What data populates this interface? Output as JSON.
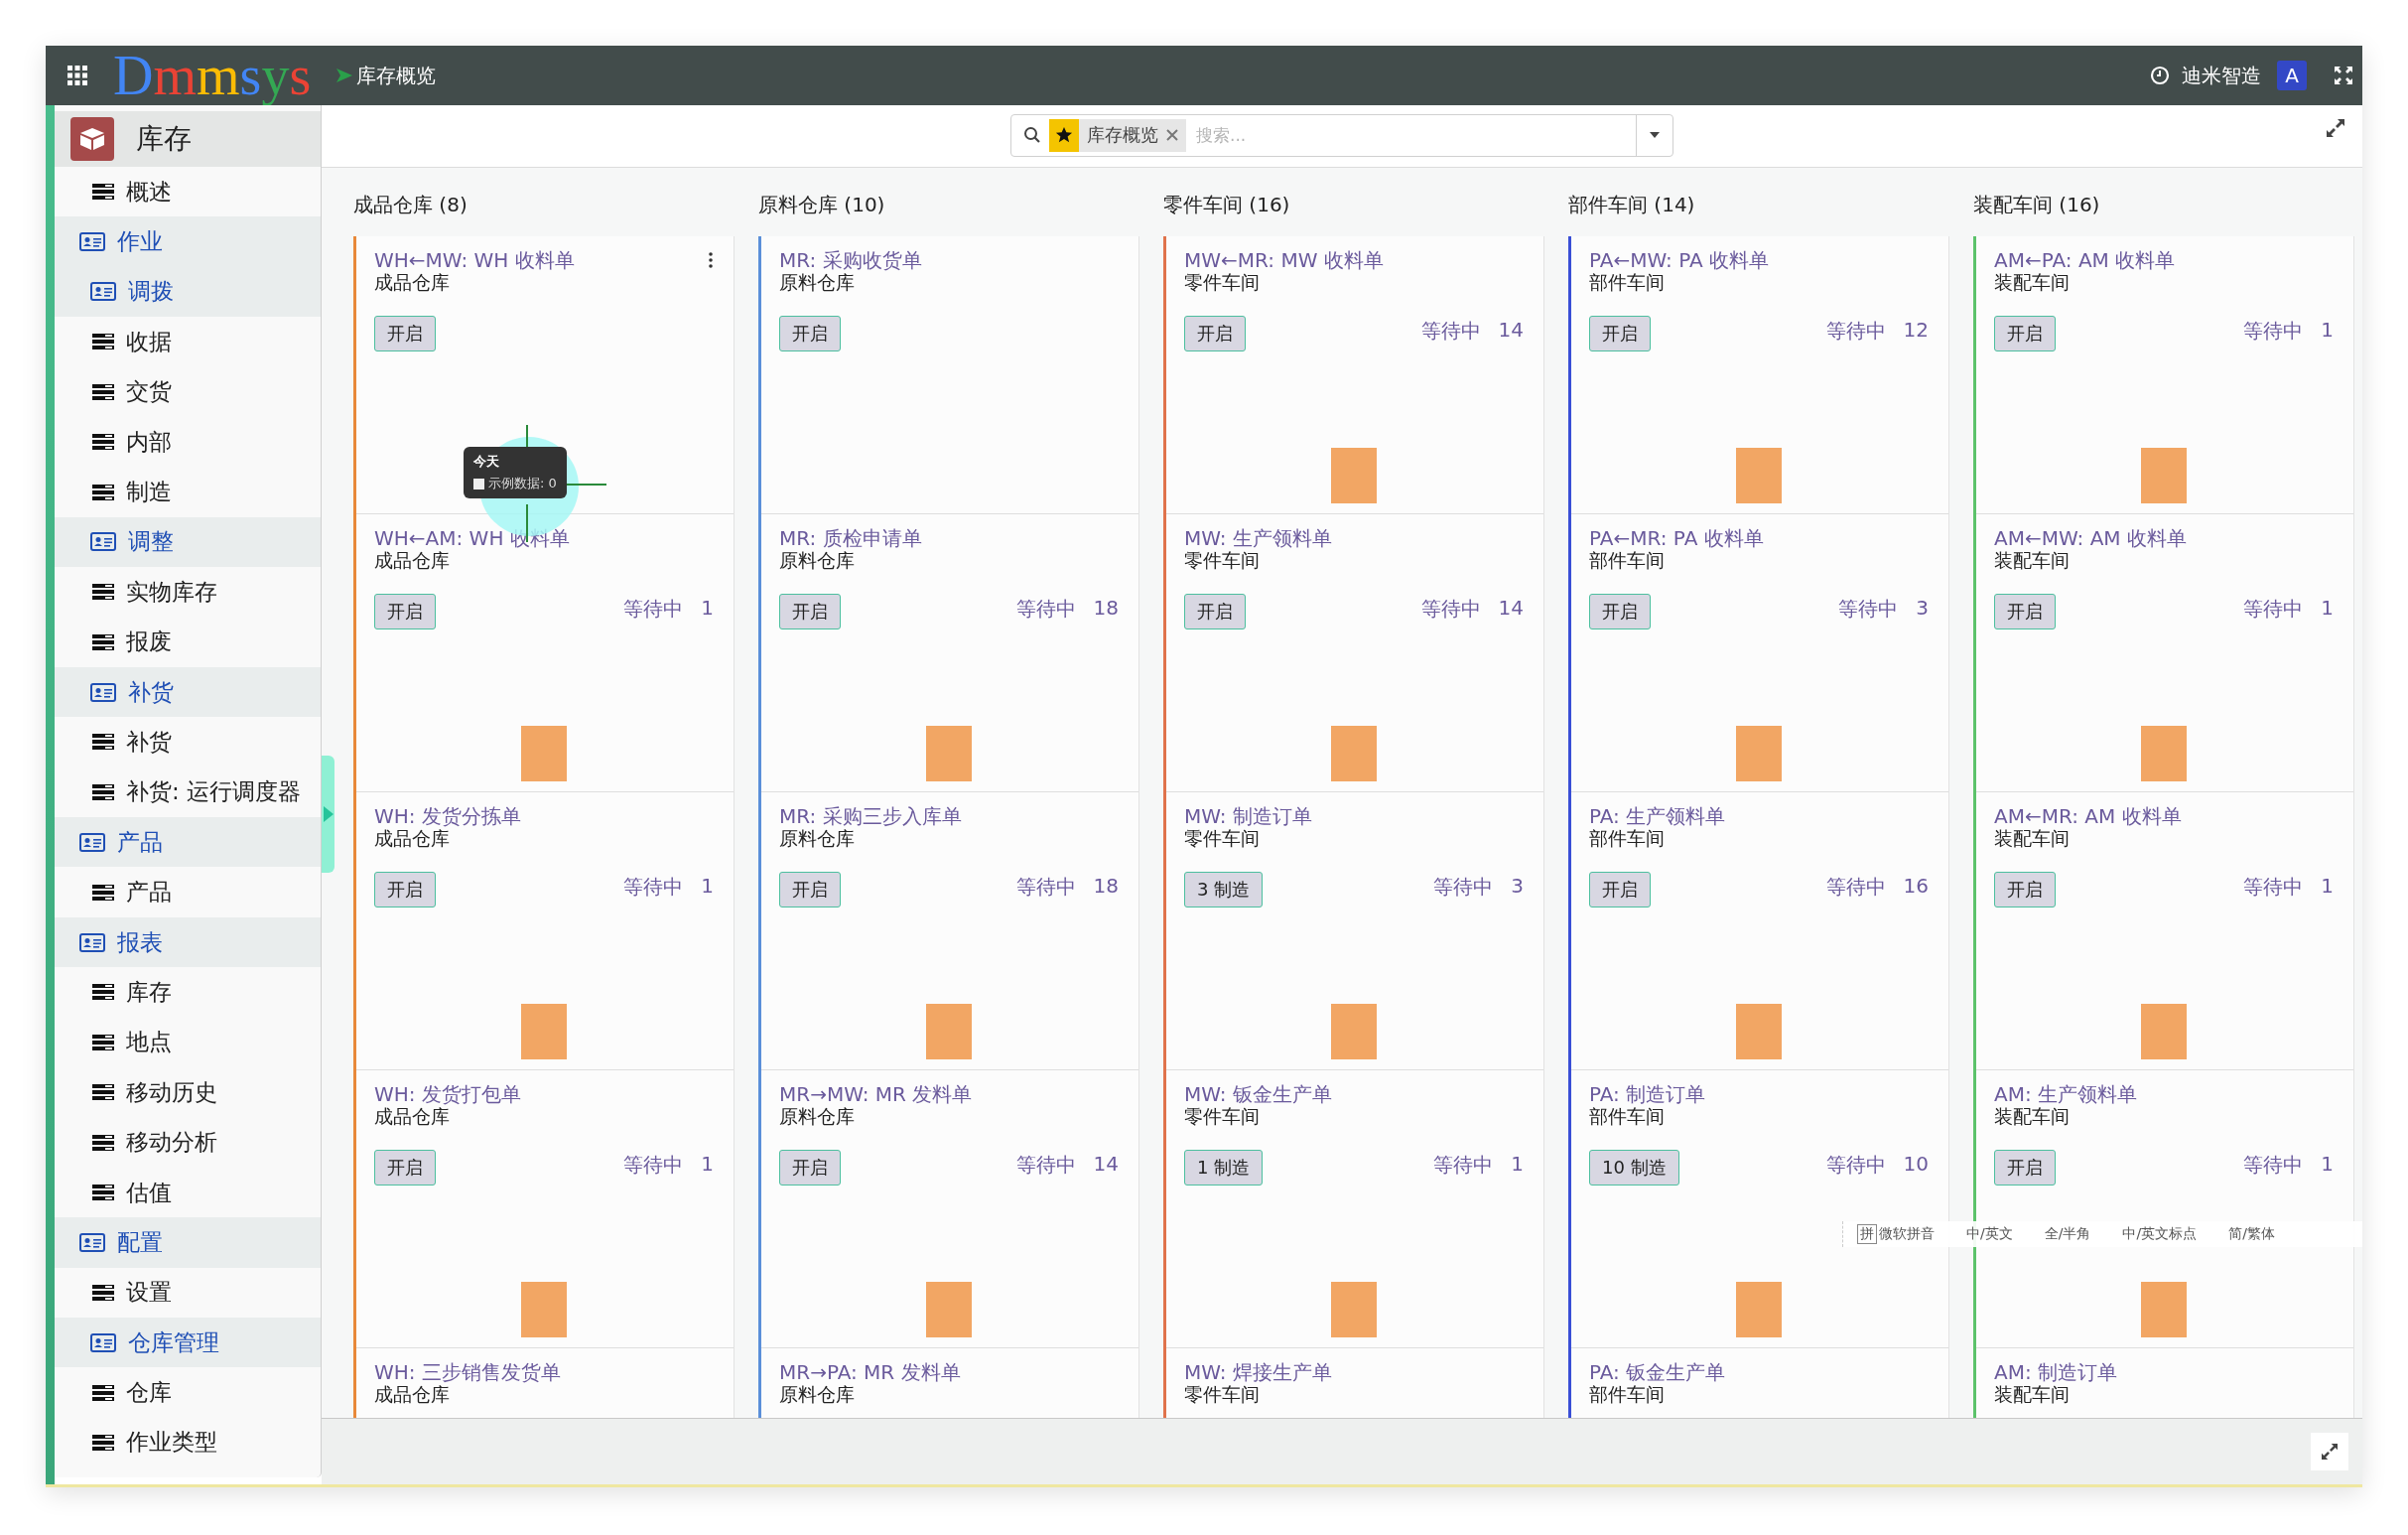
{
  "topbar": {
    "logo": "Dmmsys",
    "breadcrumb": "库存概览",
    "company": "迪米智造",
    "avatar": "A"
  },
  "sidebar": {
    "app": "库存",
    "items": [
      {
        "label": "概述",
        "kind": "item"
      },
      {
        "label": "作业",
        "kind": "section"
      },
      {
        "label": "调拨",
        "kind": "subsection"
      },
      {
        "label": "收据",
        "kind": "item"
      },
      {
        "label": "交货",
        "kind": "item"
      },
      {
        "label": "内部",
        "kind": "item"
      },
      {
        "label": "制造",
        "kind": "item"
      },
      {
        "label": "调整",
        "kind": "subsection"
      },
      {
        "label": "实物库存",
        "kind": "item"
      },
      {
        "label": "报废",
        "kind": "item"
      },
      {
        "label": "补货",
        "kind": "subsection"
      },
      {
        "label": "补货",
        "kind": "item"
      },
      {
        "label": "补货: 运行调度器",
        "kind": "item"
      },
      {
        "label": "产品",
        "kind": "section"
      },
      {
        "label": "产品",
        "kind": "item"
      },
      {
        "label": "报表",
        "kind": "section"
      },
      {
        "label": "库存",
        "kind": "item"
      },
      {
        "label": "地点",
        "kind": "item"
      },
      {
        "label": "移动历史",
        "kind": "item"
      },
      {
        "label": "移动分析",
        "kind": "item"
      },
      {
        "label": "估值",
        "kind": "item"
      },
      {
        "label": "配置",
        "kind": "section"
      },
      {
        "label": "设置",
        "kind": "item"
      },
      {
        "label": "仓库管理",
        "kind": "subsection"
      },
      {
        "label": "仓库",
        "kind": "item"
      },
      {
        "label": "作业类型",
        "kind": "item"
      }
    ]
  },
  "search": {
    "facet": "库存概览",
    "placeholder": "搜索..."
  },
  "columns": [
    {
      "title": "成品仓库 (8)",
      "color": "#e8893a",
      "cards": [
        {
          "title": "WH←MW: WH 收料单",
          "subtitle": "成品仓库",
          "button": "开启",
          "bar": false,
          "hovered": true,
          "tooltip": {
            "title": "今天",
            "text": "示例数据: 0"
          }
        },
        {
          "title": "WH←AM: WH 收料单",
          "subtitle": "成品仓库",
          "button": "开启",
          "waiting_label": "等待中",
          "waiting_count": "1",
          "bar": true,
          "hovered": false
        },
        {
          "title": "WH: 发货分拣单",
          "subtitle": "成品仓库",
          "button": "开启",
          "waiting_label": "等待中",
          "waiting_count": "1",
          "bar": true,
          "hovered": false
        },
        {
          "title": "WH: 发货打包单",
          "subtitle": "成品仓库",
          "button": "开启",
          "waiting_label": "等待中",
          "waiting_count": "1",
          "bar": true,
          "hovered": false
        },
        {
          "title": "WH: 三步销售发货单",
          "subtitle": "成品仓库",
          "bar": false,
          "hovered": false
        }
      ]
    },
    {
      "title": "原料仓库 (10)",
      "color": "#5b8fd9",
      "cards": [
        {
          "title": "MR: 采购收货单",
          "subtitle": "原料仓库",
          "button": "开启",
          "bar": false,
          "hovered": false
        },
        {
          "title": "MR: 质检申请单",
          "subtitle": "原料仓库",
          "button": "开启",
          "waiting_label": "等待中",
          "waiting_count": "18",
          "bar": true,
          "hovered": false
        },
        {
          "title": "MR: 采购三步入库单",
          "subtitle": "原料仓库",
          "button": "开启",
          "waiting_label": "等待中",
          "waiting_count": "18",
          "bar": true,
          "hovered": false
        },
        {
          "title": "MR→MW: MR 发料单",
          "subtitle": "原料仓库",
          "button": "开启",
          "waiting_label": "等待中",
          "waiting_count": "14",
          "bar": true,
          "hovered": false
        },
        {
          "title": "MR→PA: MR 发料单",
          "subtitle": "原料仓库",
          "bar": false,
          "hovered": false
        }
      ]
    },
    {
      "title": "零件车间 (16)",
      "color": "#e0734c",
      "cards": [
        {
          "title": "MW←MR: MW 收料单",
          "subtitle": "零件车间",
          "button": "开启",
          "waiting_label": "等待中",
          "waiting_count": "14",
          "bar": true,
          "hovered": false
        },
        {
          "title": "MW: 生产领料单",
          "subtitle": "零件车间",
          "button": "开启",
          "waiting_label": "等待中",
          "waiting_count": "14",
          "bar": true,
          "hovered": false
        },
        {
          "title": "MW: 制造订单",
          "subtitle": "零件车间",
          "button": "3 制造",
          "waiting_label": "等待中",
          "waiting_count": "3",
          "bar": true,
          "hovered": false
        },
        {
          "title": "MW: 钣金生产单",
          "subtitle": "零件车间",
          "button": "1 制造",
          "waiting_label": "等待中",
          "waiting_count": "1",
          "bar": true,
          "hovered": false
        },
        {
          "title": "MW: 焊接生产单",
          "subtitle": "零件车间",
          "bar": false,
          "hovered": false
        }
      ]
    },
    {
      "title": "部件车间 (14)",
      "color": "#3a4fd6",
      "cards": [
        {
          "title": "PA←MW: PA 收料单",
          "subtitle": "部件车间",
          "button": "开启",
          "waiting_label": "等待中",
          "waiting_count": "12",
          "bar": true,
          "hovered": false
        },
        {
          "title": "PA←MR: PA 收料单",
          "subtitle": "部件车间",
          "button": "开启",
          "waiting_label": "等待中",
          "waiting_count": "3",
          "bar": true,
          "hovered": false
        },
        {
          "title": "PA: 生产领料单",
          "subtitle": "部件车间",
          "button": "开启",
          "waiting_label": "等待中",
          "waiting_count": "16",
          "bar": true,
          "hovered": false
        },
        {
          "title": "PA: 制造订单",
          "subtitle": "部件车间",
          "button": "10 制造",
          "waiting_label": "等待中",
          "waiting_count": "10",
          "bar": true,
          "hovered": false
        },
        {
          "title": "PA: 钣金生产单",
          "subtitle": "部件车间",
          "bar": false,
          "hovered": false
        }
      ]
    },
    {
      "title": "装配车间 (16)",
      "color": "#5cc26a",
      "cards": [
        {
          "title": "AM←PA: AM 收料单",
          "subtitle": "装配车间",
          "button": "开启",
          "waiting_label": "等待中",
          "waiting_count": "1",
          "bar": true,
          "hovered": false
        },
        {
          "title": "AM←MW: AM 收料单",
          "subtitle": "装配车间",
          "button": "开启",
          "waiting_label": "等待中",
          "waiting_count": "1",
          "bar": true,
          "hovered": false
        },
        {
          "title": "AM←MR: AM 收料单",
          "subtitle": "装配车间",
          "button": "开启",
          "waiting_label": "等待中",
          "waiting_count": "1",
          "bar": true,
          "hovered": false
        },
        {
          "title": "AM: 生产领料单",
          "subtitle": "装配车间",
          "button": "开启",
          "waiting_label": "等待中",
          "waiting_count": "1",
          "bar": true,
          "hovered": false
        },
        {
          "title": "AM: 制造订单",
          "subtitle": "装配车间",
          "bar": false,
          "hovered": false
        }
      ]
    }
  ],
  "ime_bar": {
    "badge": "拼",
    "name": "微软拼音",
    "options": [
      "中/英文",
      "全/半角",
      "中/英文标点",
      "简/繁体"
    ]
  }
}
